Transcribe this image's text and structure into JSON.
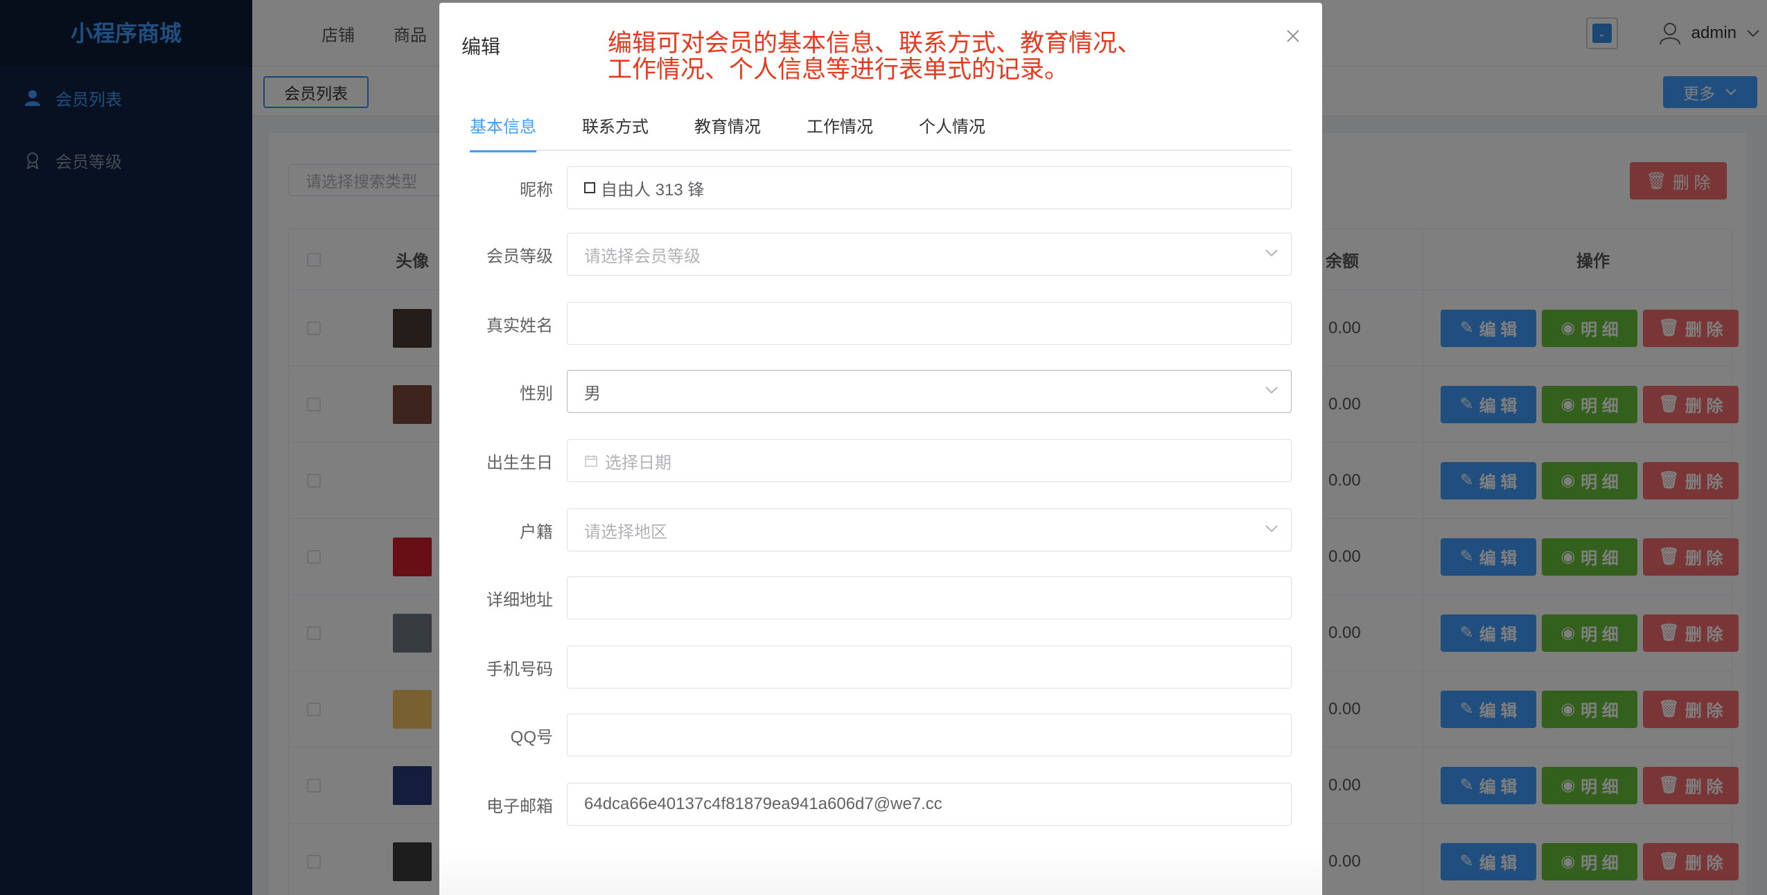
{
  "app": {
    "logo": "小程序商城"
  },
  "sidebar": {
    "items": [
      {
        "label": "会员列表",
        "icon": "user-icon",
        "active": true
      },
      {
        "label": "会员等级",
        "icon": "badge-icon",
        "active": false
      }
    ]
  },
  "header": {
    "nav": [
      "店铺",
      "商品"
    ],
    "user": "admin"
  },
  "tagsbar": {
    "tag": "会员列表",
    "more": "更多"
  },
  "content": {
    "search_placeholder": "请选择搜索类型",
    "delete_label": "删 除",
    "columns": {
      "avatar": "头像",
      "balance": "余额",
      "actions": "操作"
    },
    "rows": [
      {
        "balance": "0.00"
      },
      {
        "balance": "0.00"
      },
      {
        "balance": "0.00"
      },
      {
        "balance": "0.00"
      },
      {
        "balance": "0.00"
      },
      {
        "balance": "0.00"
      },
      {
        "balance": "0.00"
      },
      {
        "balance": "0.00"
      }
    ],
    "actions": {
      "edit": "编 辑",
      "detail": "明 细",
      "delete": "删 除"
    }
  },
  "dialog": {
    "title": "编辑",
    "annotation_line1": "编辑可对会员的基本信息、联系方式、教育情况、",
    "annotation_line2": "工作情况、个人信息等进行表单式的记录。",
    "tabs": [
      "基本信息",
      "联系方式",
      "教育情况",
      "工作情况",
      "个人情况"
    ],
    "fields": {
      "nickname": {
        "label": "昵称",
        "value": "自由人 313 锋"
      },
      "level": {
        "label": "会员等级",
        "placeholder": "请选择会员等级"
      },
      "realname": {
        "label": "真实姓名",
        "value": ""
      },
      "gender": {
        "label": "性别",
        "value": "男"
      },
      "birthday": {
        "label": "出生生日",
        "placeholder": "选择日期"
      },
      "hometown": {
        "label": "户籍",
        "placeholder": "请选择地区"
      },
      "address": {
        "label": "详细地址",
        "value": ""
      },
      "phone": {
        "label": "手机号码",
        "value": ""
      },
      "qq": {
        "label": "QQ号",
        "value": ""
      },
      "email": {
        "label": "电子邮箱",
        "value": "64dca66e40137c4f81879ea941a606d7@we7.cc"
      }
    }
  },
  "colors": {
    "primary": "#409eff",
    "success": "#67c23a",
    "danger": "#f56c6c",
    "annotation": "#e8391e",
    "sidebar": "#0f2342"
  }
}
